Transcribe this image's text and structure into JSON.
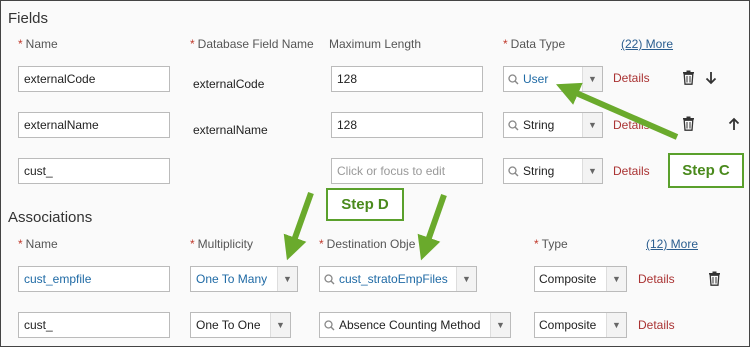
{
  "fields": {
    "title": "Fields",
    "headers": {
      "name": "Name",
      "db_field_name": "Database Field Name",
      "max_length": "Maximum Length",
      "data_type": "Data Type",
      "more": "(22) More"
    },
    "rows": [
      {
        "name": "externalCode",
        "db_field": "externalCode",
        "max_length": "128",
        "data_type": "User",
        "details": "Details"
      },
      {
        "name": "externalName",
        "db_field": "externalName",
        "max_length": "128",
        "data_type": "String",
        "details": "Details"
      },
      {
        "name": "cust_",
        "db_field": "",
        "max_length_placeholder": "Click or focus to edit",
        "data_type": "String",
        "details": "Details"
      }
    ]
  },
  "associations": {
    "title": "Associations",
    "headers": {
      "name": "Name",
      "multiplicity": "Multiplicity",
      "destination": "Destination Obje",
      "type": "Type",
      "more": "(12) More"
    },
    "rows": [
      {
        "name": "cust_empfile",
        "multiplicity": "One To Many",
        "destination": "cust_stratoEmpFiles",
        "type": "Composite",
        "details": "Details"
      },
      {
        "name": "cust_",
        "multiplicity": "One To One",
        "destination": "Absence Counting Method",
        "type": "Composite",
        "details": "Details"
      }
    ]
  },
  "annotations": {
    "step_c": "Step C",
    "step_d": "Step D",
    "arrow_color": "#6aaa2c"
  },
  "required_marker": "*"
}
